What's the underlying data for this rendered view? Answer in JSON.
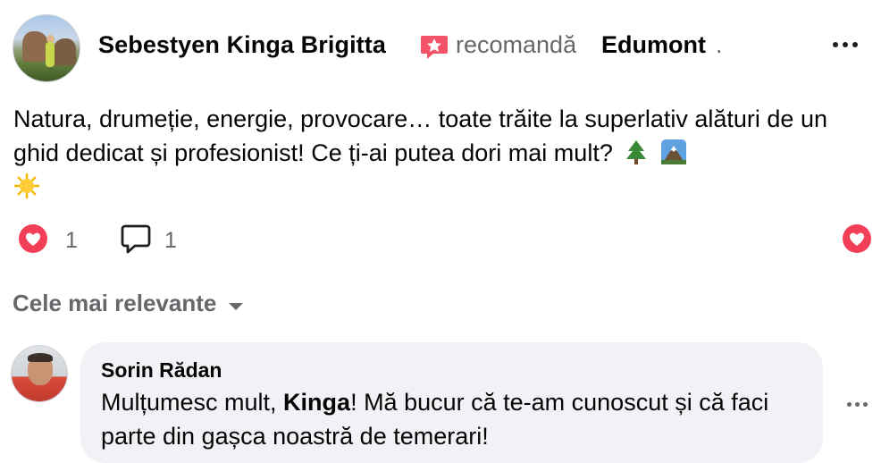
{
  "post": {
    "author": "Sebestyen Kinga Brigitta",
    "recommend_text": "recomandă",
    "page_name": "Edumont",
    "page_suffix": ".",
    "text": "Natura, drumeție, energie, provocare… toate trăite la superlativ alături de un ghid dedicat și profesionist! Ce ți-ai putea dori mai mult?",
    "emojis": [
      "evergreen-tree-emoji",
      "mountain-emoji",
      "sun-emoji"
    ],
    "reaction_count": "1",
    "comment_count": "1"
  },
  "comments_sort": {
    "label": "Cele mai relevante"
  },
  "comment": {
    "author": "Sorin Rădan",
    "text_before": "Mulțumesc mult, ",
    "mention": "Kinga",
    "text_after": "! Mă bucur că te-am cunoscut și că faci parte din gașca noastră de temerari!"
  },
  "colors": {
    "reaction_red": "#f33e58",
    "recommend_pink": "#f35369",
    "secondary_text": "#65676b",
    "bubble_bg": "#f0f2f5"
  }
}
